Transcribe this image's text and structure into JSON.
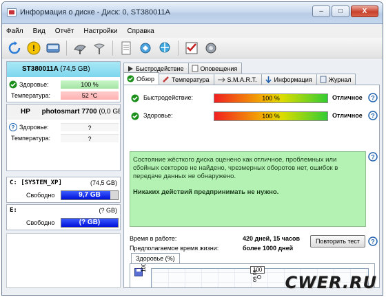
{
  "window": {
    "title": "Информация о диске - Диск: 0, ST380011A",
    "controls": {
      "minimize": "–",
      "maximize": "□",
      "close": "X"
    }
  },
  "menu": [
    "Файл",
    "Вид",
    "Отчёт",
    "Настройки",
    "Справка"
  ],
  "toolbar": {
    "icons": [
      "refresh-icon",
      "warning-icon",
      "hard-drive-icon",
      "satellite-icon",
      "antenna-icon",
      "report-icon",
      "tools-icon",
      "network-icon",
      "checklist-icon",
      "settings-icon"
    ]
  },
  "disks": [
    {
      "name": "ST380011A",
      "size": "(74,5 GB)",
      "health_label": "Здоровье:",
      "health_value": "100 %",
      "temp_label": "Температура:",
      "temp_value": "52 °C"
    },
    {
      "vendor": "HP",
      "name": "photosmart 7700",
      "size": "(0,0 GB)",
      "health_label": "Здоровье:",
      "health_value": "?",
      "temp_label": "Температура:",
      "temp_value": "?"
    }
  ],
  "partitions": [
    {
      "name": "C: [SYSTEM_XP]",
      "size": "(74,5 GB)",
      "free_label": "Свободно",
      "free_value": "9,7 GB",
      "used_fraction": 0.87
    },
    {
      "name": "E:",
      "size": "(? GB)",
      "free_label": "Свободно",
      "free_value": "(? GB)",
      "used_fraction": 0.0
    }
  ],
  "tabs_top": [
    "Быстродействие",
    "Оповещения"
  ],
  "tabs": [
    "Обзор",
    "Температура",
    "S.M.A.R.T.",
    "Информация",
    "Журнал"
  ],
  "overview": {
    "performance_label": "Быстродействие:",
    "performance_value": "100 %",
    "performance_word": "Отличное",
    "health_label": "Здоровье:",
    "health_value": "100 %",
    "health_word": "Отличное",
    "status_text": "Состояние жёсткого диска оценено как отличное, проблемных или сбойных секторов не найдено, чрезмерных оборотов нет, ошибок в передаче данных не обнаружено.",
    "advice_text": "Никаких действий предпринимать не нужно.",
    "runtime_label": "Время в работе:",
    "runtime_value": "420 дней, 15 часов",
    "lifetime_label": "Предполагаемое время жизни:",
    "lifetime_value": "более 1000 дней",
    "test_button": "Повторить тест",
    "graph_tab": "Здоровье (%)",
    "graph_axis": "100",
    "graph_point_label": "100",
    "graph_point_date": "09.06"
  },
  "watermark": "CWER.RU",
  "colors": {
    "accent_blue": "#0010d9",
    "health_green": "#a3e4a3",
    "temp_red": "#ffb0b0",
    "status_green": "#b3f2b3"
  }
}
